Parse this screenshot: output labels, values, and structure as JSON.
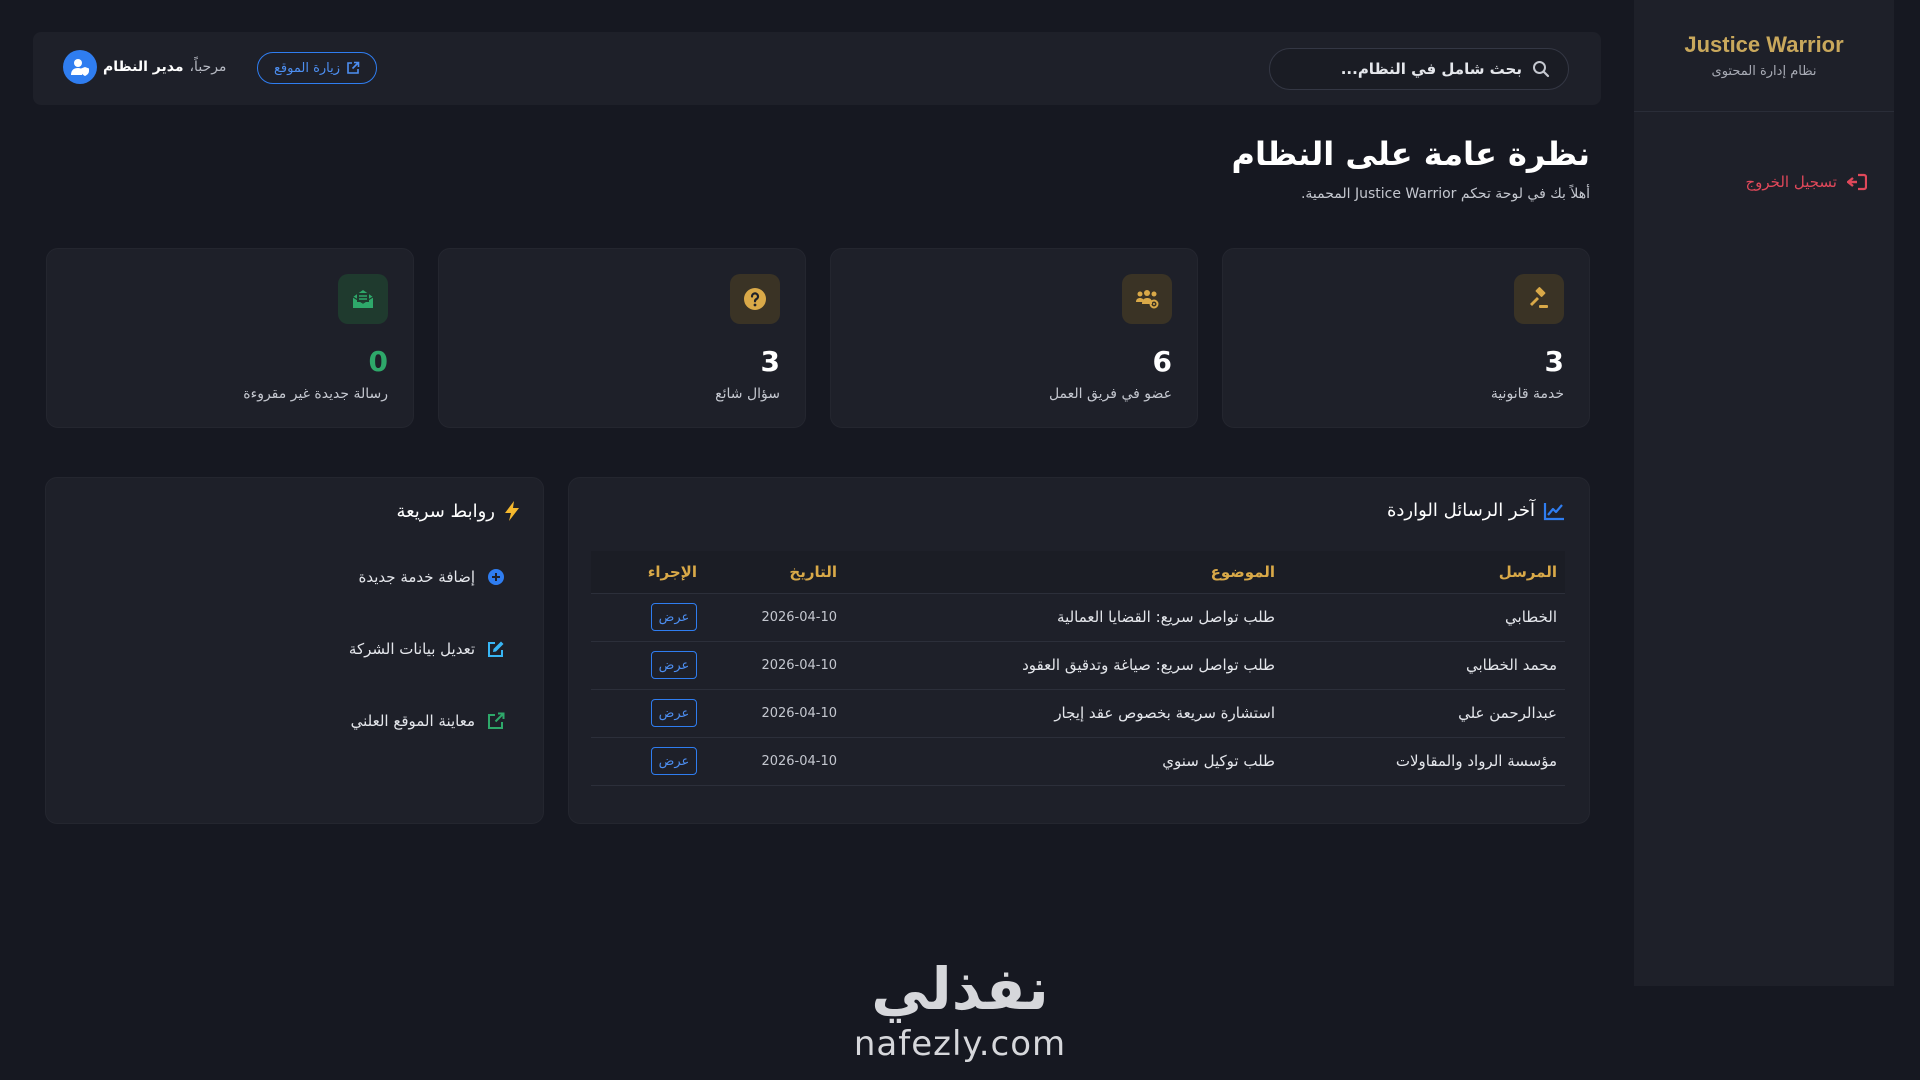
{
  "sidebar": {
    "brand_title": "Justice Warrior",
    "brand_subtitle": "نظام إدارة المحتوى",
    "logout_label": "تسجيل الخروج"
  },
  "topbar": {
    "search_placeholder": "بحث شامل في النظام...",
    "welcome_text": "مرحباً،",
    "admin_name": "مدير النظام",
    "visit_site_label": "زيارة الموقع"
  },
  "page": {
    "title": "نظرة عامة على النظام",
    "subtitle": "أهلاً بك في لوحة تحكم Justice Warrior المحمية."
  },
  "stats": [
    {
      "value": "3",
      "label": "خدمة قانونية",
      "icon": "gavel-icon",
      "color": "#d9a948"
    },
    {
      "value": "6",
      "label": "عضو في فريق العمل",
      "icon": "users-cog-icon",
      "color": "#d9a948"
    },
    {
      "value": "3",
      "label": "سؤال شائع",
      "icon": "question-circle-icon",
      "color": "#d9a948"
    },
    {
      "value": "0",
      "label": "رسالة جديدة غير مقروءة",
      "icon": "envelope-open-icon",
      "color": "#2ea86a"
    }
  ],
  "messages": {
    "title": "آخر الرسائل الواردة",
    "columns": [
      "المرسل",
      "الموضوع",
      "التاريخ",
      "الإجراء"
    ],
    "rows": [
      {
        "sender": "الخطابي",
        "subject": "طلب تواصل سريع: القضايا العمالية",
        "date": "2026-04-10",
        "action": "عرض"
      },
      {
        "sender": "محمد الخطابي",
        "subject": "طلب تواصل سريع: صياغة وتدقيق العقود",
        "date": "2026-04-10",
        "action": "عرض"
      },
      {
        "sender": "عبدالرحمن علي",
        "subject": "استشارة سريعة بخصوص عقد إيجار",
        "date": "2026-04-10",
        "action": "عرض"
      },
      {
        "sender": "مؤسسة الرواد والمقاولات",
        "subject": "طلب توكيل سنوي",
        "date": "2026-04-10",
        "action": "عرض"
      }
    ]
  },
  "quick_links": {
    "title": "روابط سريعة",
    "items": [
      {
        "label": "إضافة خدمة جديدة",
        "icon": "plus-circle-icon"
      },
      {
        "label": "تعديل بيانات الشركة",
        "icon": "edit-icon"
      },
      {
        "label": "معاينة الموقع العلني",
        "icon": "external-link-icon"
      }
    ]
  },
  "watermark": {
    "arabic": "نفذلي",
    "latin": "nafezly.com"
  },
  "colors": {
    "background": "#161821",
    "panel": "#1e2029",
    "accent_gold": "#d9a948",
    "accent_blue": "#2f7df0",
    "danger": "#e0485a",
    "success": "#2ea86a"
  }
}
